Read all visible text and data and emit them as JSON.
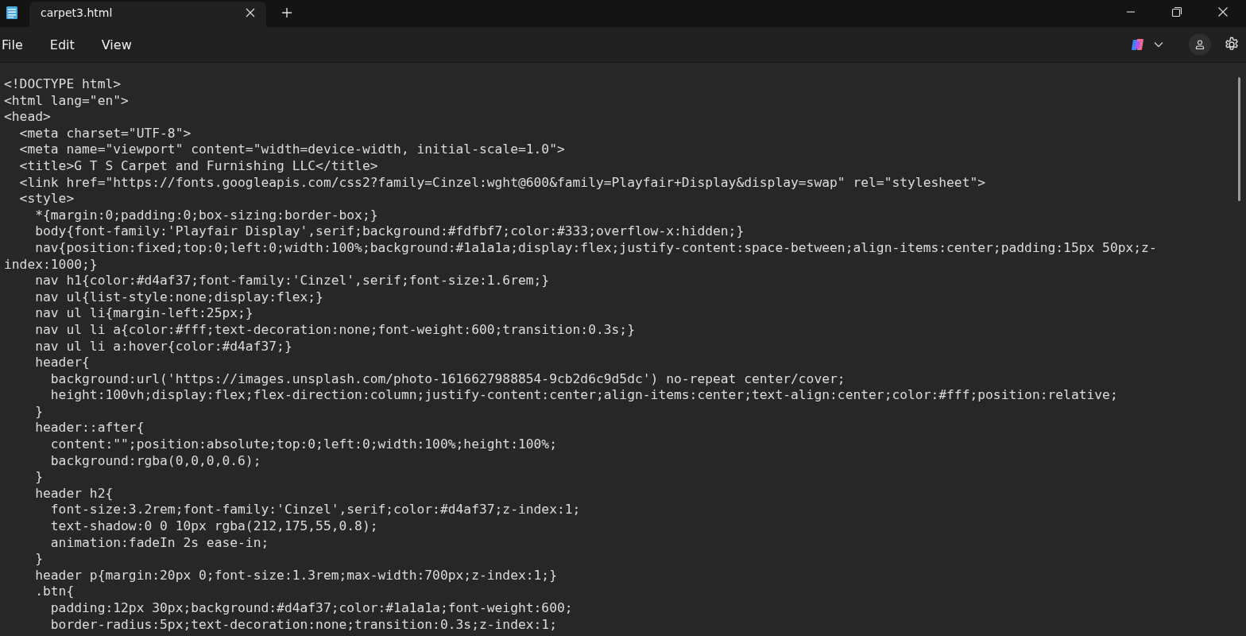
{
  "tabs": [
    {
      "title": "carpet3.html",
      "selected": true
    }
  ],
  "menu": [
    "File",
    "Edit",
    "View"
  ],
  "editor": {
    "lines": [
      "<!DOCTYPE html>",
      "<html lang=\"en\">",
      "<head>",
      "  <meta charset=\"UTF-8\">",
      "  <meta name=\"viewport\" content=\"width=device-width, initial-scale=1.0\">",
      "  <title>G T S Carpet and Furnishing LLC</title>",
      "  <link href=\"https://fonts.googleapis.com/css2?family=Cinzel:wght@600&family=Playfair+Display&display=swap\" rel=\"stylesheet\">",
      "  <style>",
      "    *{margin:0;padding:0;box-sizing:border-box;}",
      "    body{font-family:'Playfair Display',serif;background:#fdfbf7;color:#333;overflow-x:hidden;}",
      "    nav{position:fixed;top:0;left:0;width:100%;background:#1a1a1a;display:flex;justify-content:space-between;align-items:center;padding:15px 50px;z-",
      "index:1000;}",
      "    nav h1{color:#d4af37;font-family:'Cinzel',serif;font-size:1.6rem;}",
      "    nav ul{list-style:none;display:flex;}",
      "    nav ul li{margin-left:25px;}",
      "    nav ul li a{color:#fff;text-decoration:none;font-weight:600;transition:0.3s;}",
      "    nav ul li a:hover{color:#d4af37;}",
      "    header{",
      "      background:url('https://images.unsplash.com/photo-1616627988854-9cb2d6c9d5dc') no-repeat center/cover;",
      "      height:100vh;display:flex;flex-direction:column;justify-content:center;align-items:center;text-align:center;color:#fff;position:relative;",
      "    }",
      "    header::after{",
      "      content:\"\";position:absolute;top:0;left:0;width:100%;height:100%;",
      "      background:rgba(0,0,0,0.6);",
      "    }",
      "    header h2{",
      "      font-size:3.2rem;font-family:'Cinzel',serif;color:#d4af37;z-index:1;",
      "      text-shadow:0 0 10px rgba(212,175,55,0.8);",
      "      animation:fadeIn 2s ease-in;",
      "    }",
      "    header p{margin:20px 0;font-size:1.3rem;max-width:700px;z-index:1;}",
      "    .btn{",
      "      padding:12px 30px;background:#d4af37;color:#1a1a1a;font-weight:600;",
      "      border-radius:5px;text-decoration:none;transition:0.3s;z-index:1;"
    ]
  }
}
